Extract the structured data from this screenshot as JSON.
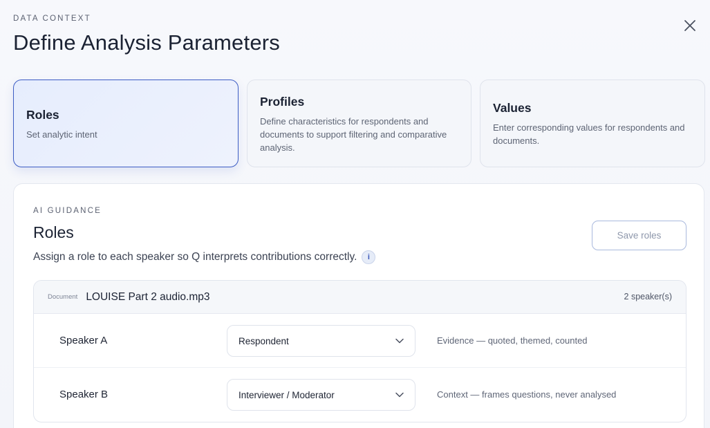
{
  "header": {
    "eyebrow": "DATA CONTEXT",
    "title": "Define Analysis Parameters"
  },
  "steps": [
    {
      "title": "Roles",
      "description": "Set analytic intent",
      "active": true
    },
    {
      "title": "Profiles",
      "description": "Define characteristics for respondents and documents to support filtering and comparative analysis.",
      "active": false
    },
    {
      "title": "Values",
      "description": "Enter corresponding values for respondents and documents.",
      "active": false
    }
  ],
  "panel": {
    "eyebrow": "AI GUIDANCE",
    "title": "Roles",
    "subtitle": "Assign a role to each speaker so Q interprets contributions correctly.",
    "info_glyph": "i",
    "save_label": "Save roles"
  },
  "document": {
    "label": "Document",
    "name": "LOUISE Part 2 audio.mp3",
    "speaker_count": "2 speaker(s)",
    "speakers": [
      {
        "name": "Speaker A",
        "role": "Respondent",
        "role_description": "Evidence — quoted, themed, counted"
      },
      {
        "name": "Speaker B",
        "role": "Interviewer / Moderator",
        "role_description": "Context — frames questions, never analysed"
      }
    ]
  },
  "icons": {
    "close": "close-icon",
    "chevron": "chevron-down-icon",
    "info": "info-icon"
  },
  "colors": {
    "accent": "#3c5cc4",
    "active_step_bg": "#e6edfd"
  }
}
